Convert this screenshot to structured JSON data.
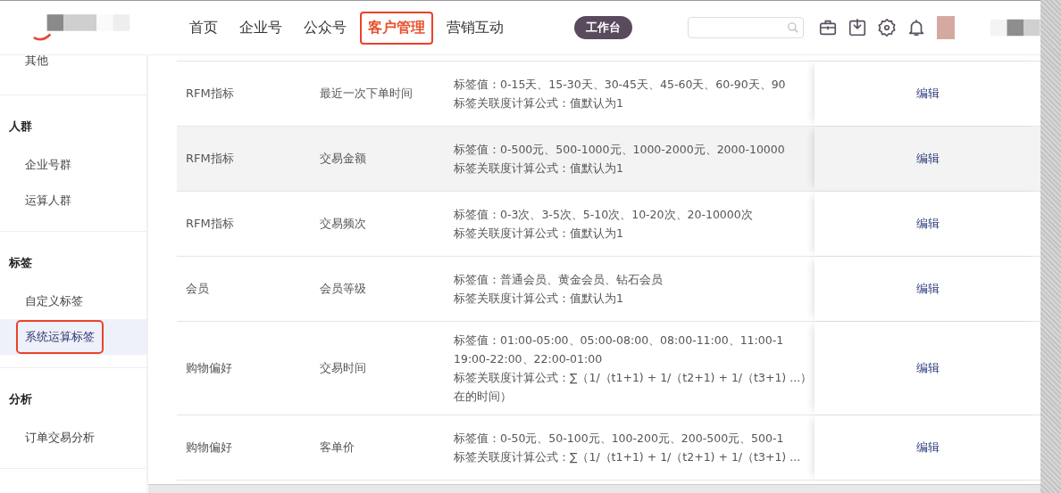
{
  "header": {
    "nav": [
      {
        "label": "首页",
        "selected": false
      },
      {
        "label": "企业号",
        "selected": false
      },
      {
        "label": "公众号",
        "selected": false
      },
      {
        "label": "客户管理",
        "selected": true
      },
      {
        "label": "营销互动",
        "selected": false
      }
    ],
    "workbench_button": "工作台"
  },
  "sidebar": {
    "groups": [
      {
        "items": [
          {
            "label": "其他",
            "selected": false
          }
        ]
      },
      {
        "title": "人群",
        "items": [
          {
            "label": "企业号群",
            "selected": false
          },
          {
            "label": "运算人群",
            "selected": false
          }
        ]
      },
      {
        "title": "标签",
        "items": [
          {
            "label": "自定义标签",
            "selected": false
          },
          {
            "label": "系统运算标签",
            "selected": true
          }
        ]
      },
      {
        "title": "分析",
        "items": [
          {
            "label": "订单交易分析",
            "selected": false
          }
        ]
      }
    ]
  },
  "table": {
    "rows": [
      {
        "category": "RFM指标",
        "name": "最近一次下单时间",
        "description": [
          "标签值：0-15天、15-30天、30-45天、45-60天、60-90天、90",
          "标签关联度计算公式：值默认为1"
        ],
        "action": "编辑",
        "highlighted": false
      },
      {
        "category": "RFM指标",
        "name": "交易金额",
        "description": [
          "标签值：0-500元、500-1000元、1000-2000元、2000-10000",
          "标签关联度计算公式：值默认为1"
        ],
        "action": "编辑",
        "highlighted": true
      },
      {
        "category": "RFM指标",
        "name": "交易频次",
        "description": [
          "标签值：0-3次、3-5次、5-10次、10-20次、20-10000次",
          "标签关联度计算公式：值默认为1"
        ],
        "action": "编辑",
        "highlighted": false
      },
      {
        "category": "会员",
        "name": "会员等级",
        "description": [
          "标签值：普通会员、黄金会员、钻石会员",
          "标签关联度计算公式：值默认为1"
        ],
        "action": "编辑",
        "highlighted": false
      },
      {
        "category": "购物偏好",
        "name": "交易时间",
        "description": [
          "标签值：01:00-05:00、05:00-08:00、08:00-11:00、11:00-1",
          "19:00-22:00、22:00-01:00",
          "标签关联度计算公式：∑（1/（t1+1) + 1/（t2+1) + 1/（t3+1) ...）",
          "在的时间）"
        ],
        "action": "编辑",
        "highlighted": false
      },
      {
        "category": "购物偏好",
        "name": "客单价",
        "description": [
          "标签值：0-50元、50-100元、100-200元、200-500元、500-1",
          "标签关联度计算公式：∑（1/（t1+1) + 1/（t2+1) + 1/（t3+1) ..."
        ],
        "action": "编辑",
        "highlighted": false
      }
    ]
  }
}
